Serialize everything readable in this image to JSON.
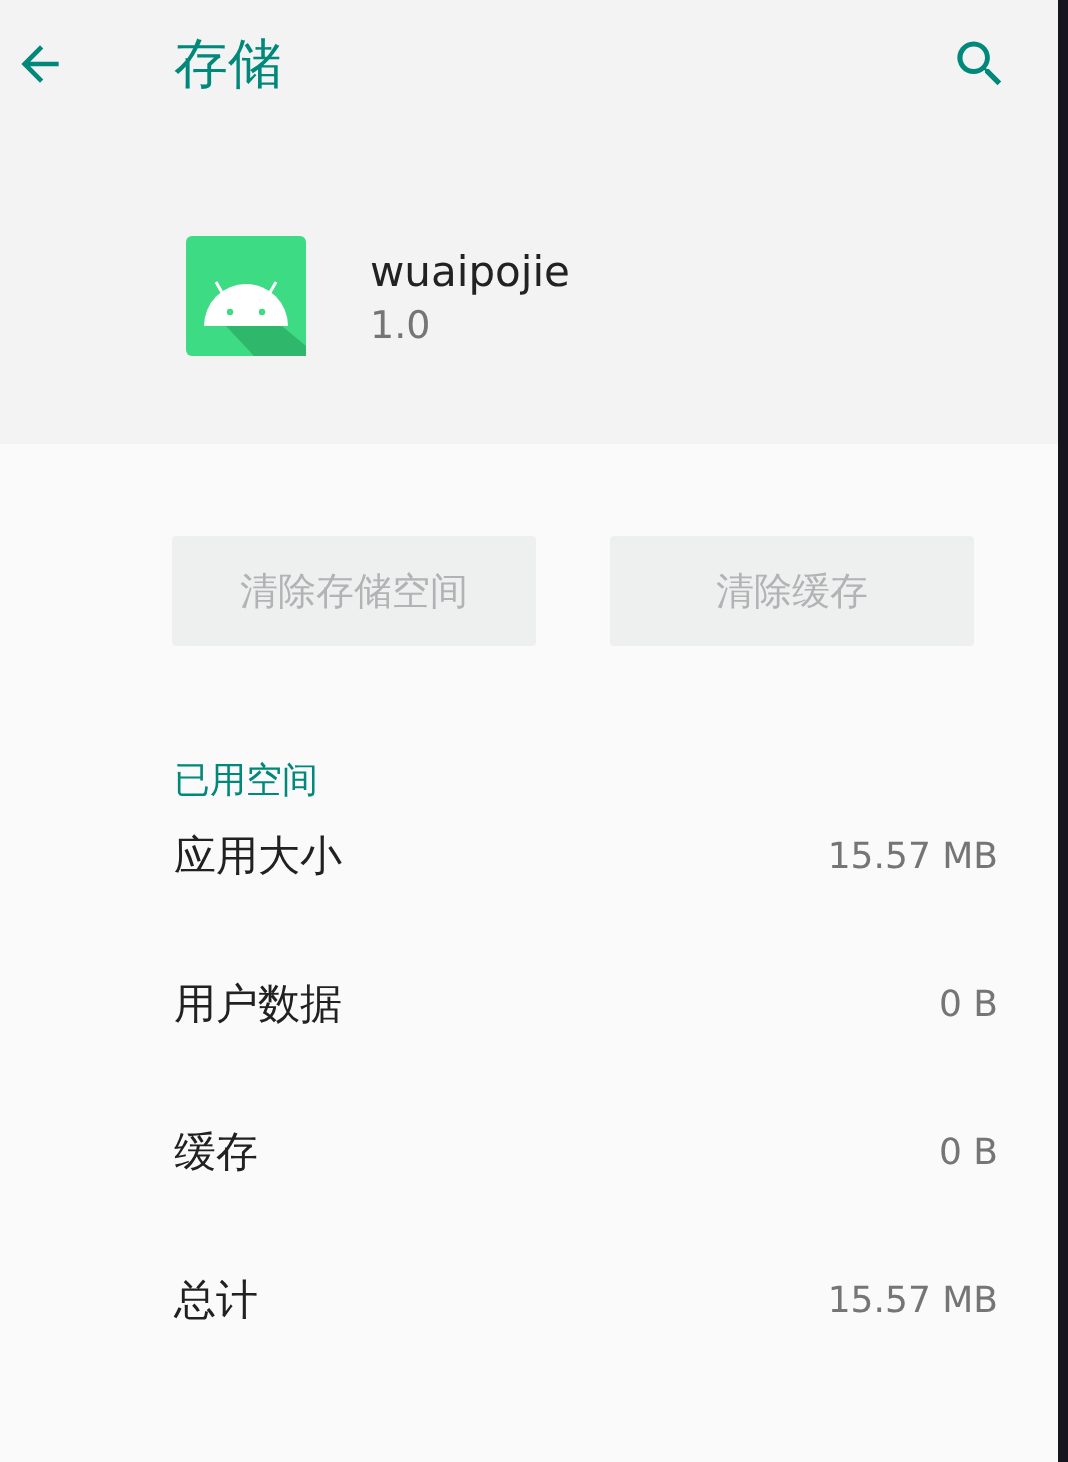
{
  "toolbar": {
    "title": "存储"
  },
  "app": {
    "name": "wuaipojie",
    "version": "1.0"
  },
  "buttons": [
    {
      "label": "清除存储空间",
      "disabled": true
    },
    {
      "label": "清除缓存",
      "disabled": true
    }
  ],
  "section": {
    "title": "已用空间"
  },
  "rows": [
    {
      "label": "应用大小",
      "value": "15.57 MB"
    },
    {
      "label": "用户数据",
      "value": "0 B"
    },
    {
      "label": "缓存",
      "value": "0 B"
    },
    {
      "label": "总计",
      "value": "15.57 MB"
    }
  ]
}
